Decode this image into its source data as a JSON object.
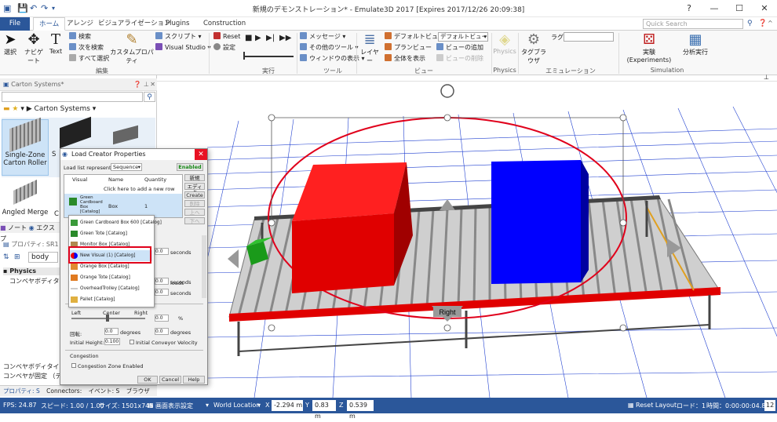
{
  "window": {
    "title": "新規のデモンストレーション* - Emulate3D 2017 [Expires 2017/12/26 20:09:38]",
    "controls": {
      "help": "?",
      "minimize": "—",
      "maximize": "☐",
      "close": "✕"
    }
  },
  "tabs": [
    {
      "label": "File"
    },
    {
      "label": "ホーム"
    },
    {
      "label": "アレンジ"
    },
    {
      "label": "ビジュアライゼーション"
    },
    {
      "label": "Plugins"
    },
    {
      "label": "Construction"
    }
  ],
  "quick_search": {
    "placeholder": "Quick Search"
  },
  "ribbon": {
    "edit": {
      "group_label": "編集",
      "select": "選択",
      "navigate": "ナビゲート",
      "text": "Text",
      "search": "検索",
      "search_next": "次を検索",
      "select_all": "すべて選択",
      "custom_property": "カスタムプロパティ",
      "script": "スクリプト",
      "visual_studio": "Visual Studio"
    },
    "run": {
      "group_label": "実行",
      "reset": "Reset",
      "settings": "設定"
    },
    "tools": {
      "group_label": "ツール",
      "message": "メッセージ",
      "other_tools": "その他のツール",
      "window_view": "ウィンドウの表示"
    },
    "view": {
      "group_label": "ビュー",
      "layer": "レイヤー",
      "default_view": "デフォルトビュー",
      "plan_view": "プランビュー",
      "show_all": "全体を表示",
      "add_view": "ビューの追加",
      "delete_view": "ビューの削除",
      "view_select": "デフォルトビュー"
    },
    "physics": {
      "group_label": "Physics",
      "label": "Physics"
    },
    "emulation": {
      "group_label": "エミュレーション (Emulation)",
      "tag_browser": "タグブラウザ",
      "tag_label": "ラグ"
    },
    "simulation": {
      "group_label": "Simulation",
      "experiments": "実験 (Experiments)",
      "analysis": "分析実行"
    }
  },
  "catalog": {
    "header": "Carton Systems*",
    "breadcrumb": "Carton Systems",
    "items": [
      {
        "label": "Single-Zone Carton Roller"
      },
      {
        "label": "S"
      },
      {
        "label": "Angled Merge"
      },
      {
        "label": "C"
      }
    ]
  },
  "left_tabs": {
    "note": "ノート",
    "explorer": "エクスプ"
  },
  "properties": {
    "header": "プロパティ: SR1",
    "object_select": "body",
    "category": "Physics",
    "row1": "コンベヤボディタイプ",
    "footer1": "コンベヤボディタイプ (Con",
    "footer2": "コンベヤが固定 （デフ",
    "bottom_tabs": [
      "プロパティ: S",
      "Connectors:",
      "イベント: S",
      "ブラウザ"
    ]
  },
  "dialog": {
    "title": "Load Creator Properties",
    "represents_label": "Load list represents a:",
    "represents_value": "Sequence",
    "enabled": "Enabled",
    "columns": [
      "Visual",
      "Name",
      "Quantity"
    ],
    "add_row": "Click here to add a new row",
    "row": {
      "visual": "Green Cardboard Box [Catalog]",
      "name": "Box",
      "quantity": "1"
    },
    "side_buttons": [
      "新規",
      "エディタ",
      "Create",
      "削除",
      "上へ",
      "下へ"
    ],
    "dropdown": [
      "Green Cardboard Box 600 [Catalog]",
      "Green Tote [Catalog]",
      "Monitor Box [Catalog]",
      "New Visual (1) [Catalog]",
      "Orange Box [Catalog]",
      "Orange Tote [Catalog]",
      "OverheadTrolley [Catalog]",
      "Pallet [Catalog]"
    ],
    "fields": {
      "seconds": "seconds",
      "loads": "loads",
      "degrees": "degrees",
      "pct": "%",
      "value0": "0.0",
      "value_h": "0.100"
    },
    "align": {
      "left": "Left",
      "center": "Center",
      "right": "Right"
    },
    "rotation_label": "回転:",
    "initial_height": "Initial Height:",
    "initial_velocity": "Initial Conveyor Velocity",
    "congestion_label": "Congestion",
    "congestion_enabled": "Congestion Zone Enabled",
    "ok": "OK",
    "cancel": "Cancel",
    "help": "Help"
  },
  "scene": {
    "right_label": "Right",
    "left_label": "Left"
  },
  "status": {
    "fps": "FPS: 24.87",
    "speed": "スピード: 1.00 / 1.00",
    "size": "サイズ: 1501x745",
    "display": "画面表示設定",
    "world": "World Location",
    "x_label": "X",
    "x": "-2.294 m",
    "y_label": "Y",
    "y": "0.83 m",
    "z_label": "Z",
    "z": "0.539 m",
    "reset_layout": "Reset Layout",
    "load": "ロード：1",
    "time": "時間：0:00:00:04.82",
    "count": "12"
  },
  "colors": {
    "accent": "#2b579a",
    "red": "#ff0000",
    "blue": "#0000ff",
    "highlight": "#e0001b"
  }
}
